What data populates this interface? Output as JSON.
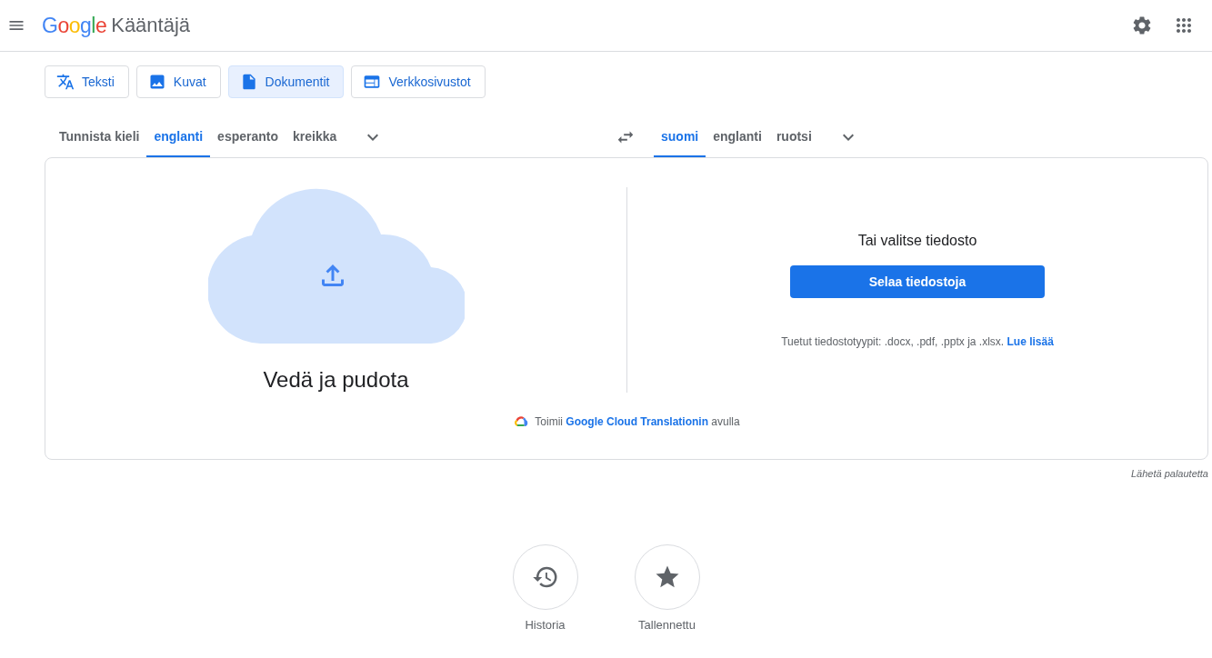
{
  "header": {
    "logo": "Google",
    "product": "Kääntäjä"
  },
  "modes": [
    {
      "kind": "text",
      "label": "Teksti",
      "selected": false
    },
    {
      "kind": "image",
      "label": "Kuvat",
      "selected": false
    },
    {
      "kind": "document",
      "label": "Dokumentit",
      "selected": true
    },
    {
      "kind": "website",
      "label": "Verkkosivustot",
      "selected": false
    }
  ],
  "source_languages": [
    {
      "label": "Tunnista kieli",
      "selected": false
    },
    {
      "label": "englanti",
      "selected": true
    },
    {
      "label": "esperanto",
      "selected": false
    },
    {
      "label": "kreikka",
      "selected": false
    }
  ],
  "target_languages": [
    {
      "label": "suomi",
      "selected": true
    },
    {
      "label": "englanti",
      "selected": false
    },
    {
      "label": "ruotsi",
      "selected": false
    }
  ],
  "upload": {
    "drop_label": "Vedä ja pudota",
    "choose_label": "Tai valitse tiedosto",
    "browse_button": "Selaa tiedostoja",
    "supported_text": "Tuetut tiedostotyypit: .docx, .pdf, .pptx ja .xlsx.",
    "learn_more": "Lue lisää"
  },
  "attribution": {
    "prefix": "Toimii",
    "link": "Google Cloud Translationin",
    "suffix": "avulla"
  },
  "feedback": "Lähetä palautetta",
  "shortcuts": [
    {
      "kind": "history",
      "label": "Historia"
    },
    {
      "kind": "saved",
      "label": "Tallennettu"
    }
  ]
}
